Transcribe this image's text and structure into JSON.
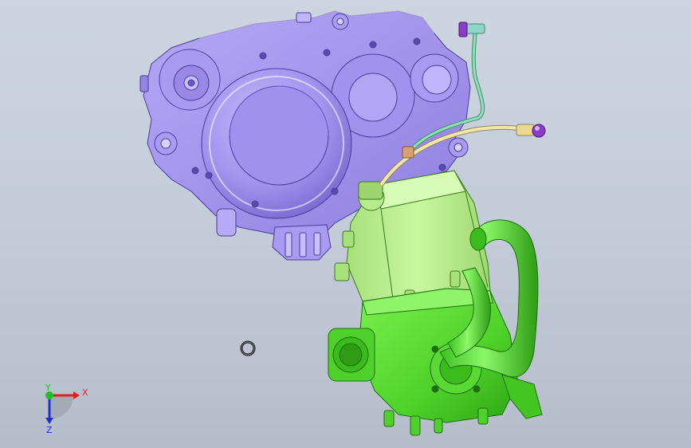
{
  "viewport": {
    "background_top": "#ccd5e0",
    "background_bottom": "#b4bdc9"
  },
  "colors": {
    "crankcase": "#a495ee",
    "crankcase_dark": "#6f5fc4",
    "cylinder": "#b9f08c",
    "cylinder_dark": "#7fc24a",
    "head": "#5fe23a",
    "head_dark": "#2f9e1a",
    "pipe_yellow": "#f2e6a8",
    "pipe_green": "#8fe0b4",
    "fitting_purple": "#8a3cc8"
  },
  "triad": {
    "x_label": "X",
    "y_label": "Y",
    "z_label": "Z",
    "x_color": "#e02020",
    "y_color": "#20c020",
    "z_color": "#2030d0"
  },
  "icons": [
    "axis-triad-icon"
  ]
}
